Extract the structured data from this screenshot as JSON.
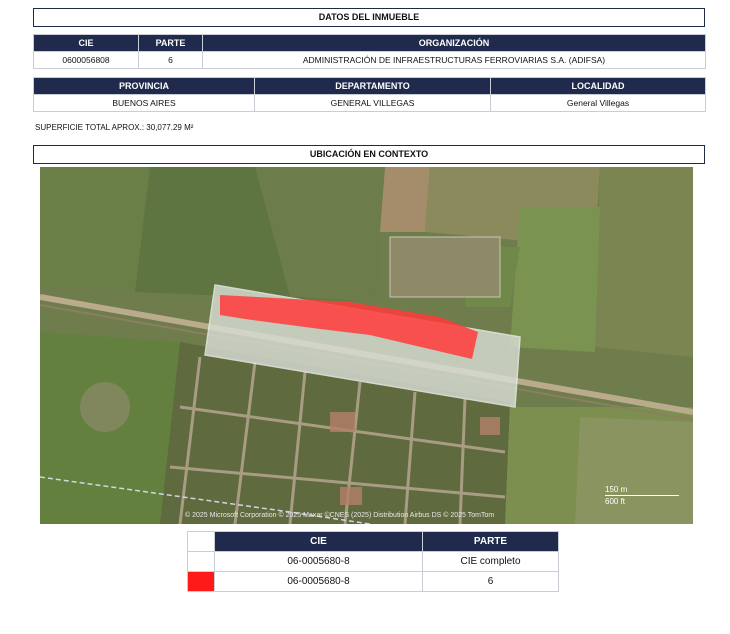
{
  "datos": {
    "title": "DATOS DEL INMUEBLE",
    "headers": {
      "cie": "CIE",
      "parte": "PARTE",
      "organizacion": "ORGANIZACIÓN"
    },
    "row": {
      "cie": "0600056808",
      "parte": "6",
      "organizacion": "ADMINISTRACIÓN DE INFRAESTRUCTURAS FERROVIARIAS S.A. (ADIFSA)"
    }
  },
  "ubic": {
    "headers": {
      "provincia": "PROVINCIA",
      "departamento": "DEPARTAMENTO",
      "localidad": "LOCALIDAD"
    },
    "row": {
      "provincia": "BUENOS AIRES",
      "departamento": "GENERAL VILLEGAS",
      "localidad": "General Villegas"
    }
  },
  "superficie": "SUPERFICIE TOTAL APROX.: 30,077.29 M²",
  "contexto_title": "UBICACIÓN EN CONTEXTO",
  "map": {
    "attribution": "© 2025 Microsoft Corporation © 2025 Maxar ©CNES (2025) Distribution Airbus DS © 2025 TomTom",
    "scale_m": "150 m",
    "scale_ft": "600 ft",
    "highlight_color": "#ff3b3b"
  },
  "legend": {
    "headers": {
      "cie": "CIE",
      "parte": "PARTE"
    },
    "rows": [
      {
        "cie": "06-0005680-8",
        "parte": "CIE completo",
        "swatch": "#ffffff"
      },
      {
        "cie": "06-0005680-8",
        "parte": "6",
        "swatch": "#ff1a1a"
      }
    ]
  }
}
